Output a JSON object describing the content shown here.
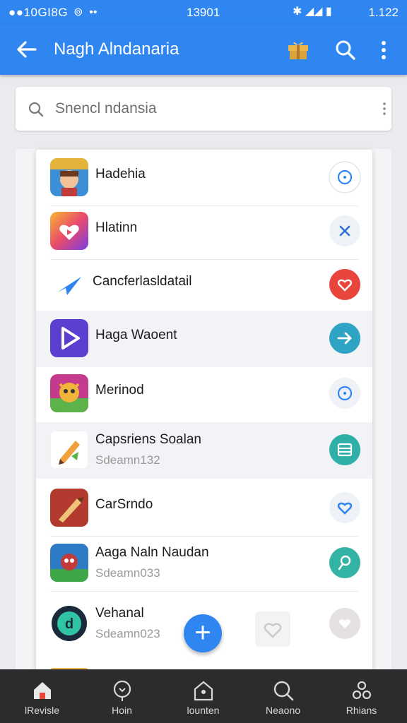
{
  "status": {
    "left": "●●10GI8G",
    "center": "13901",
    "right": "1.122"
  },
  "appbar": {
    "title": "Nagh Alndanaria",
    "icons": [
      "back-arrow-icon",
      "gift-icon",
      "search-icon",
      "more-vert-icon"
    ]
  },
  "search": {
    "value": "Snencl ndansia"
  },
  "apps": [
    {
      "name": "Hadehia",
      "sub": "",
      "action_color": "#ffffff",
      "icon": "game-character-icon"
    },
    {
      "name": "Hlatinn",
      "sub": "",
      "action_color": "#eef2f7",
      "icon": "heart-play-icon"
    },
    {
      "name": "Cancferlasldatail",
      "sub": "",
      "action_color": "#e8453c",
      "icon": "paper-plane-icon"
    },
    {
      "name": "Haga Waoent",
      "sub": "",
      "action_color": "#2ea3c4",
      "icon": "play-triangle-icon"
    },
    {
      "name": "Merinod",
      "sub": "",
      "action_color": "#eef2f7",
      "icon": "game-monster-icon"
    },
    {
      "name": "Capsriens Soalan",
      "sub": "Sdeamn132",
      "action_color": "#2eb0a9",
      "icon": "pencil-tool-icon"
    },
    {
      "name": "CarSrndo",
      "sub": "",
      "action_color": "#eef2f7",
      "icon": "pen-icon"
    },
    {
      "name": "Aaga Naln Naudan",
      "sub": "Sdeamn033",
      "action_color": "#33b3a4",
      "icon": "game-hero-icon"
    },
    {
      "name": "Vehanal",
      "sub": "Sdeamn023",
      "action_color": "#e4e1e0",
      "icon": "circle-d-icon"
    }
  ],
  "tabs": [
    {
      "label": "lRevisle",
      "icon": "home-icon"
    },
    {
      "label": "Hoin",
      "icon": "location-pin-icon"
    },
    {
      "label": "lounten",
      "icon": "home-outline-icon"
    },
    {
      "label": "Neaono",
      "icon": "search-icon"
    },
    {
      "label": "Rhians",
      "icon": "people-icon"
    }
  ],
  "colors": {
    "primary": "#2f86f0",
    "bottom_bar": "#2c2c2e"
  }
}
